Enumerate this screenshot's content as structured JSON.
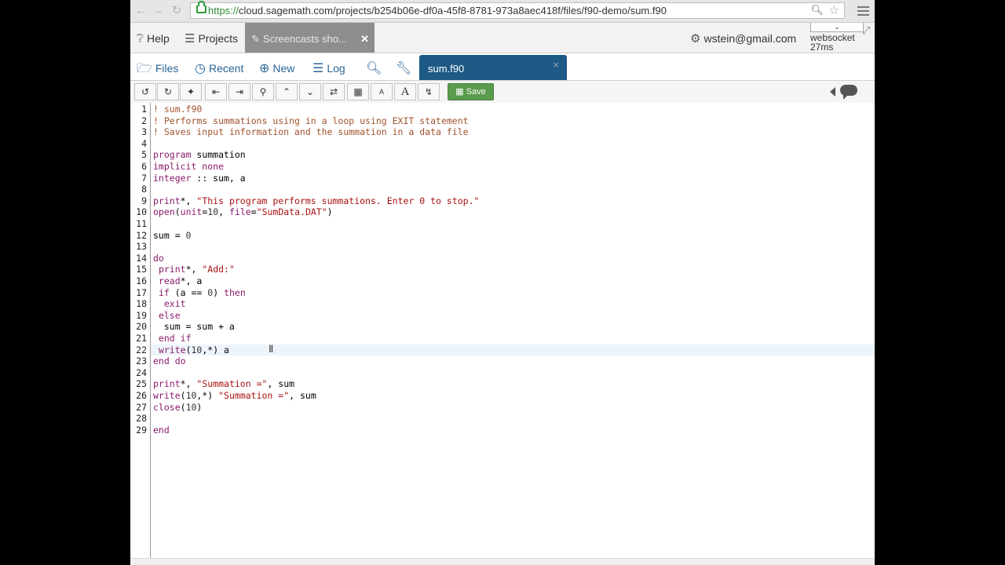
{
  "browser": {
    "url_scheme": "https://",
    "url_rest": "cloud.sagemath.com/projects/b254b06e-df0a-45f8-8781-973a8aec418f/files/f90-demo/sum.f90"
  },
  "topnav": {
    "help_label": "Help",
    "projects_label": "Projects",
    "project_tab_label": "Screencasts sho...",
    "user_label": "wstein@gmail.com",
    "websocket_label": "websocket",
    "latency_label": "27ms"
  },
  "filenav": {
    "files_label": "Files",
    "recent_label": "Recent",
    "new_label": "New",
    "log_label": "Log",
    "open_file_tab": "sum.f90"
  },
  "toolbar": {
    "save_label": "Save",
    "buttons": [
      "undo-icon",
      "redo-icon",
      "magic-wand-icon",
      "indent-left-icon",
      "indent-right-icon",
      "search-icon",
      "chevron-up-icon",
      "chevron-down-icon",
      "replace-icon",
      "film-icon",
      "font-small-icon",
      "font-large-icon",
      "bolt-icon"
    ]
  },
  "editor": {
    "lines": [
      "! sum.f90",
      "! Performs summations using in a loop using EXIT statement",
      "! Saves input information and the summation in a data file",
      "",
      "program summation",
      "implicit none",
      "integer :: sum, a",
      "",
      "print*, \"This program performs summations. Enter 0 to stop.\"",
      "open(unit=10, file=\"SumData.DAT\")",
      "",
      "sum = 0",
      "",
      "do",
      " print*, \"Add:\"",
      " read*, a",
      " if (a == 0) then",
      "  exit",
      " else",
      "  sum = sum + a",
      " end if",
      " write(10,*) a",
      "end do",
      "",
      "print*, \"Summation =\", sum",
      "write(10,*) \"Summation =\", sum",
      "close(10)",
      "",
      "end"
    ],
    "active_line": 22
  },
  "colors": {
    "save_button": "#5a9b4e",
    "file_tab": "#1d5a85",
    "comment": "#a0522d",
    "keyword": "#8b1a6c",
    "string": "#a11"
  }
}
